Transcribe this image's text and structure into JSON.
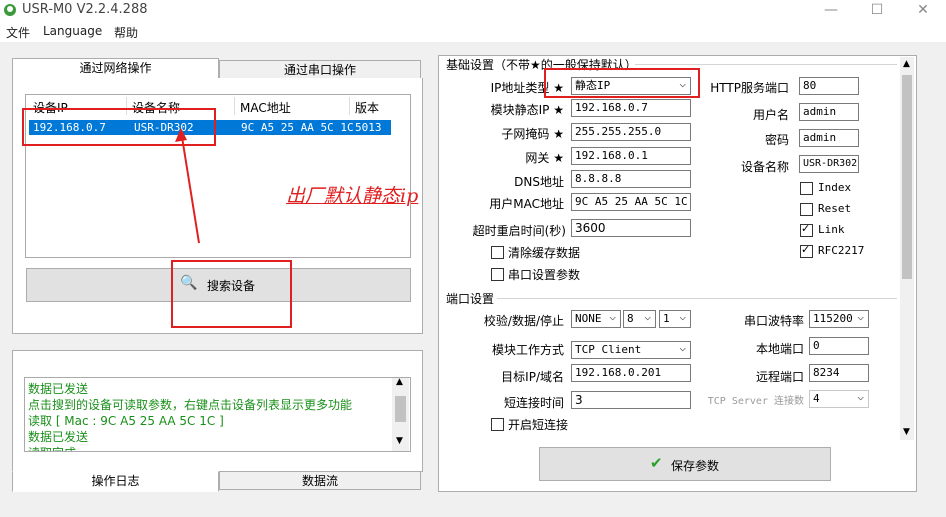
{
  "window": {
    "title": "USR-M0 V2.2.4.288"
  },
  "menu": [
    "文件",
    "Language",
    "帮助"
  ],
  "left": {
    "tabs": [
      "通过网络操作",
      "通过串口操作"
    ],
    "columns": [
      "设备IP",
      "设备名称",
      "MAC地址",
      "版本"
    ],
    "rows": [
      {
        "ip": "192.168.0.7",
        "name": "USR-DR302",
        "mac": "9C A5 25 AA 5C 1C",
        "version": "5013"
      }
    ],
    "annotation": "出厂默认静态ip",
    "search_button": "搜索设备",
    "log_lines": [
      "数据已发送",
      "点击搜到的设备可读取参数，右键点击设备列表显示更多功能",
      "读取 [ Mac : 9C A5 25 AA 5C 1C ]",
      "数据已发送",
      "读取完成"
    ],
    "bottom_tabs": [
      "操作日志",
      "数据流"
    ]
  },
  "right": {
    "basic_title": "基础设置（不带★的一般保持默认）",
    "ip_type_label": "IP地址类型",
    "ip_type_value": "静态IP",
    "static_ip_label": "模块静态IP",
    "static_ip_value": "192.168.0.7",
    "subnet_label": "子网掩码",
    "subnet_value": "255.255.255.0",
    "gateway_label": "网关",
    "gateway_value": "192.168.0.1",
    "dns_label": "DNS地址",
    "dns_value": "8.8.8.8",
    "mac_label": "用户MAC地址",
    "mac_value": "9C A5 25 AA 5C 1C",
    "timeout_label": "超时重启时间(秒)",
    "timeout_value": "3600",
    "clear_cache_label": "清除缓存数据",
    "serial_params_label": "串口设置参数",
    "star": "★",
    "http_port_label": "HTTP服务端口",
    "http_port_value": "80",
    "username_label": "用户名",
    "username_value": "admin",
    "password_label": "密码",
    "password_value": "admin",
    "device_name_label": "设备名称",
    "device_name_value": "USR-DR302",
    "checks": [
      {
        "label": "Index",
        "checked": false
      },
      {
        "label": "Reset",
        "checked": false
      },
      {
        "label": "Link",
        "checked": true
      },
      {
        "label": "RFC2217",
        "checked": true
      }
    ],
    "port_title": "端口设置",
    "parity_label": "校验/数据/停止",
    "parity_value": "NONE",
    "data_bits_value": "8",
    "stop_bits_value": "1",
    "baud_label": "串口波特率",
    "baud_value": "115200",
    "work_mode_label": "模块工作方式",
    "work_mode_value": "TCP Client",
    "local_port_label": "本地端口",
    "local_port_value": "0",
    "target_label": "目标IP/域名",
    "target_value": "192.168.0.201",
    "remote_port_label": "远程端口",
    "remote_port_value": "8234",
    "short_conn_label": "短连接时间",
    "short_conn_value": "3",
    "tcp_conn_label": "TCP Server 连接数",
    "tcp_conn_value": "4",
    "enable_short_label": "开启短连接",
    "save_button": "保存参数"
  },
  "colors": {
    "selection": "#0078d7",
    "annotation": "#e02020",
    "log_text": "#1a8f1a"
  }
}
